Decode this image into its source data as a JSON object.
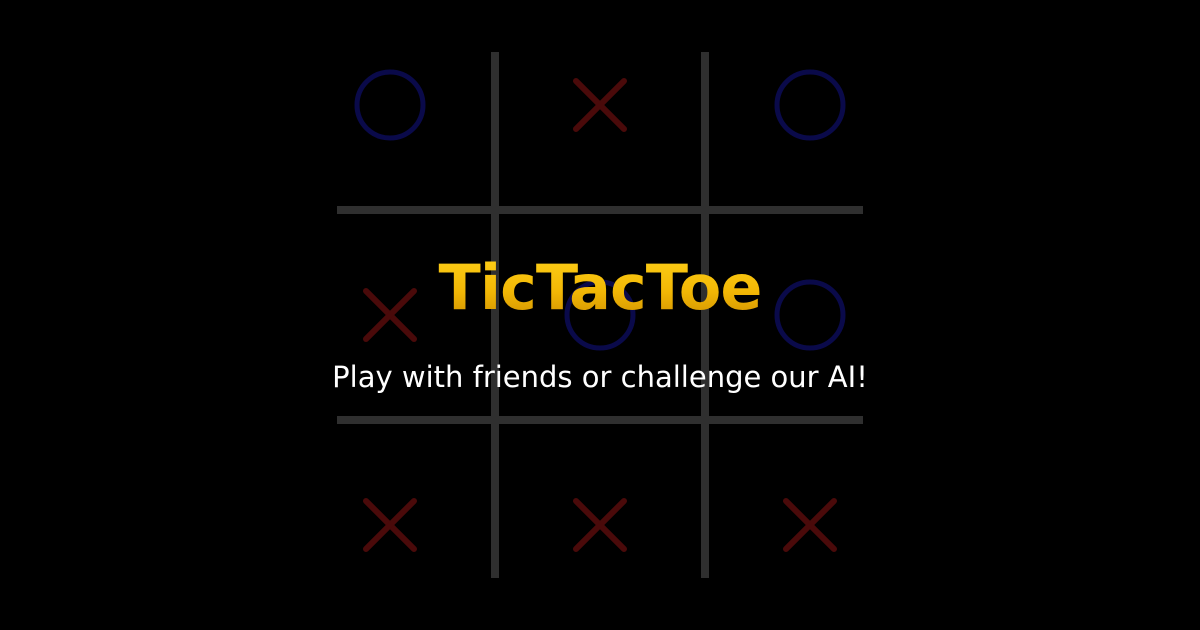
{
  "app": {
    "title": "TicTacToe",
    "tagline": "Play with friends or challenge our AI!"
  },
  "board": {
    "cells": [
      "O",
      "X",
      "O",
      "X",
      "O",
      "O",
      "X",
      "X",
      "X"
    ]
  },
  "colors": {
    "background": "#000000",
    "grid": "#2f2f2f",
    "x_mark": "#4a0a0a",
    "o_mark": "#0a0a4a",
    "title_gold": "#f2b705",
    "tagline": "#ffffff"
  }
}
